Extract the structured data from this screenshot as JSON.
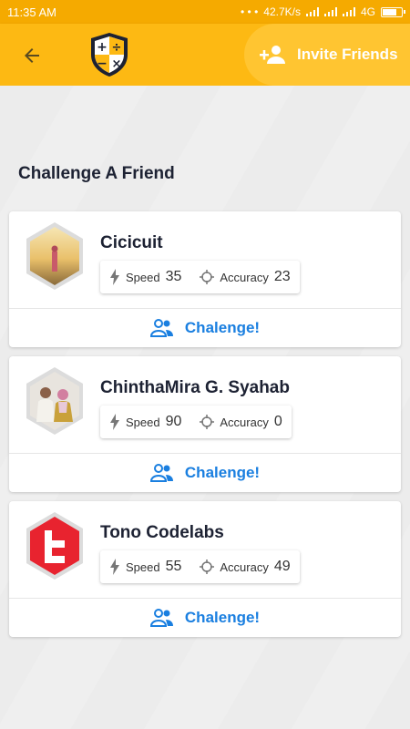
{
  "status_bar": {
    "time": "11:35 AM",
    "network_speed": "42.7K/s",
    "network_type": "4G"
  },
  "app_bar": {
    "back_icon": "arrow-left-icon",
    "logo_icon": "math-shield-logo",
    "invite_label": "Invite Friends",
    "invite_icon": "person-add-icon"
  },
  "colors": {
    "primary": "#fdb913",
    "accent_blue": "#1a7fe0",
    "text_dark": "#1d2233"
  },
  "section_title": "Challenge A Friend",
  "friends": [
    {
      "name": "Cicicuit",
      "speed_label": "Speed",
      "speed": "35",
      "accuracy_label": "Accuracy",
      "accuracy": "23",
      "challenge_label": "Chalenge!"
    },
    {
      "name": "ChinthaMira G. Syahab",
      "speed_label": "Speed",
      "speed": "90",
      "accuracy_label": "Accuracy",
      "accuracy": "0",
      "challenge_label": "Chalenge!"
    },
    {
      "name": "Tono Codelabs",
      "speed_label": "Speed",
      "speed": "55",
      "accuracy_label": "Accuracy",
      "accuracy": "49",
      "challenge_label": "Chalenge!"
    }
  ]
}
